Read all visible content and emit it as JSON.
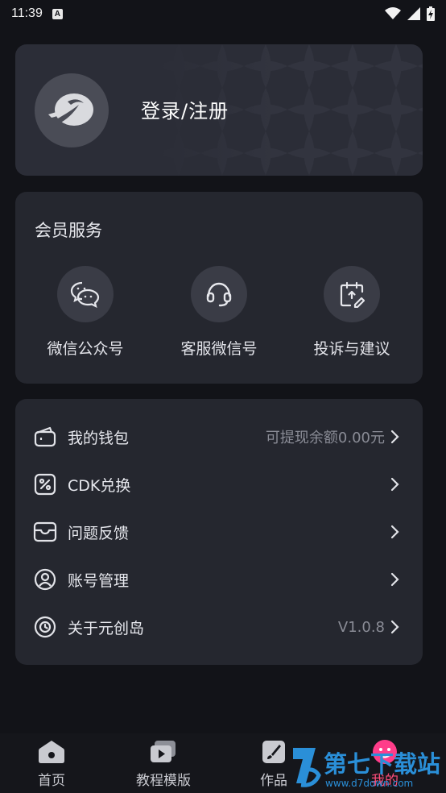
{
  "status_bar": {
    "time": "11:39",
    "notification_badge": "A"
  },
  "profile": {
    "login_label": "登录/注册"
  },
  "member_services": {
    "title": "会员服务",
    "items": [
      {
        "label": "微信公众号",
        "icon": "wechat-icon"
      },
      {
        "label": "客服微信号",
        "icon": "headset-icon"
      },
      {
        "label": "投诉与建议",
        "icon": "feedback-edit-icon"
      }
    ]
  },
  "menu": {
    "items": [
      {
        "label": "我的钱包",
        "value": "可提现余额0.00元",
        "icon": "wallet-icon"
      },
      {
        "label": "CDK兑换",
        "value": "",
        "icon": "percent-coupon-icon"
      },
      {
        "label": "问题反馈",
        "value": "",
        "icon": "inbox-icon"
      },
      {
        "label": "账号管理",
        "value": "",
        "icon": "user-circle-icon"
      },
      {
        "label": "关于元创岛",
        "value": "V1.0.8",
        "icon": "clock-icon"
      }
    ]
  },
  "bottom_nav": {
    "items": [
      {
        "label": "首页",
        "icon": "home-icon"
      },
      {
        "label": "教程模版",
        "icon": "video-icon"
      },
      {
        "label": "作品",
        "icon": "brush-icon"
      },
      {
        "label": "我的",
        "icon": "smile-icon"
      }
    ]
  },
  "watermark": {
    "brand": "第七下载站",
    "url": "www.d7down.com"
  },
  "colors": {
    "background": "#121318",
    "card": "#25272f",
    "profile_card": "#2b2d37",
    "accent": "#ff4d7a",
    "muted_text": "#8a8c96"
  }
}
